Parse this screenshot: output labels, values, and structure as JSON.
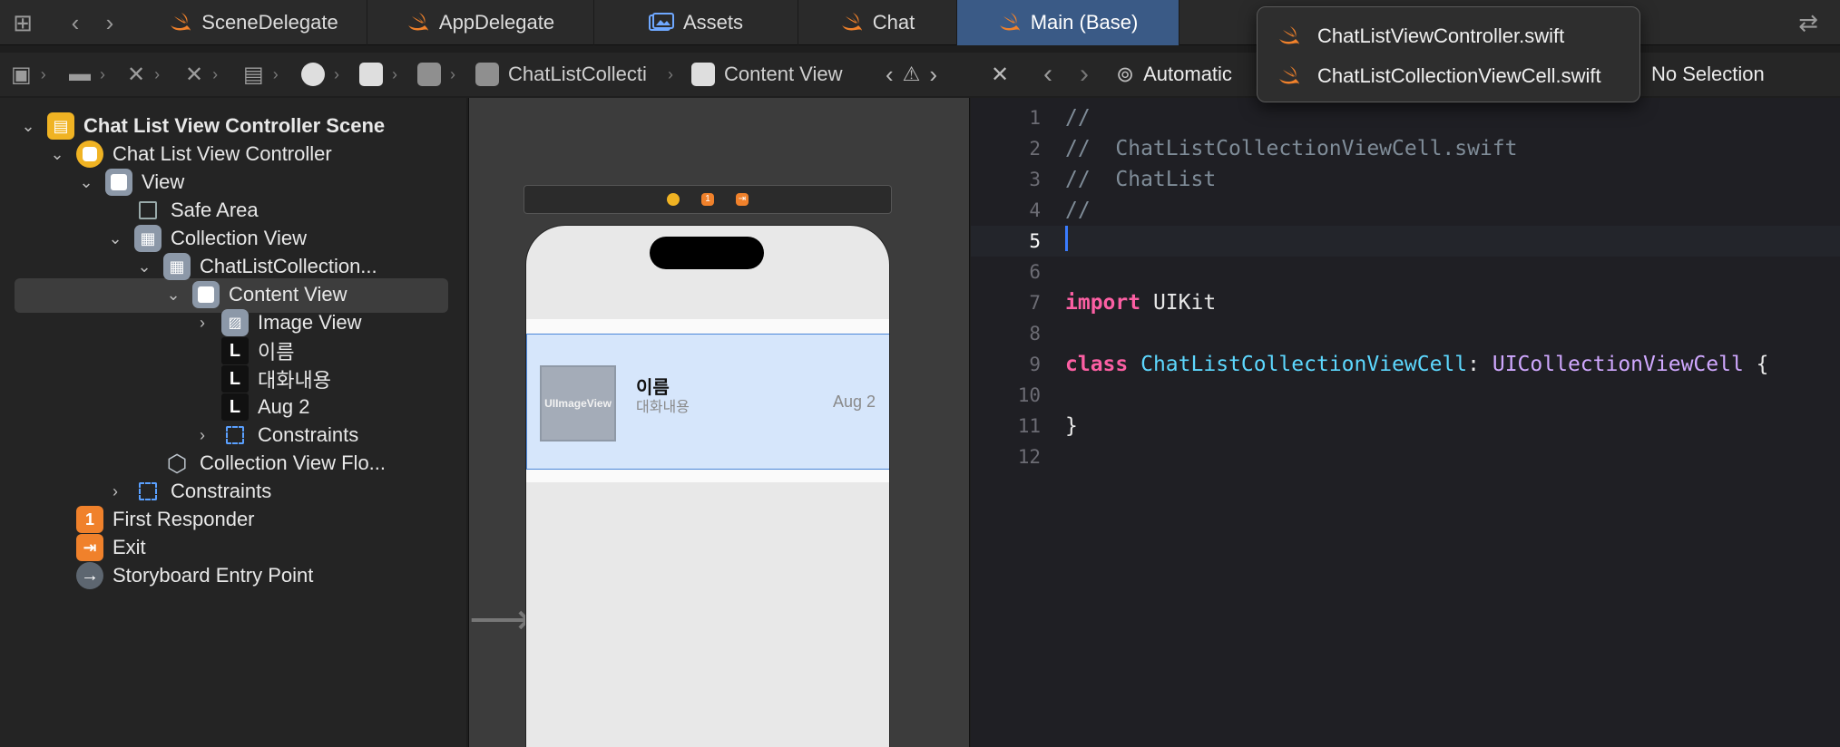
{
  "tabs": [
    {
      "label": "SceneDelegate"
    },
    {
      "label": "AppDelegate"
    },
    {
      "label": "Assets"
    },
    {
      "label": "Chat"
    },
    {
      "label": "Main (Base)"
    }
  ],
  "jump_bar": {
    "collection_cell_label": "ChatListCollecti",
    "content_view_label": "Content View"
  },
  "assistant_bar": {
    "mode_label": "Automatic",
    "selection_label": "No Selection"
  },
  "popup": {
    "items": [
      "ChatListViewController.swift",
      "ChatListCollectionViewCell.swift"
    ]
  },
  "outline": {
    "rows": [
      {
        "label": "Chat List View Controller Scene"
      },
      {
        "label": "Chat List View Controller"
      },
      {
        "label": "View"
      },
      {
        "label": "Safe Area"
      },
      {
        "label": "Collection View"
      },
      {
        "label": "ChatListCollection..."
      },
      {
        "label": "Content View"
      },
      {
        "label": "Image View"
      },
      {
        "label": "이름"
      },
      {
        "label": "대화내용"
      },
      {
        "label": "Aug 2"
      },
      {
        "label": "Constraints"
      },
      {
        "label": "Collection View Flo..."
      },
      {
        "label": "Constraints"
      },
      {
        "label": "First Responder"
      },
      {
        "label": "Exit"
      },
      {
        "label": "Storyboard Entry Point"
      }
    ],
    "icon_glyphs": {
      "label": "L",
      "first_responder": "1"
    }
  },
  "canvas": {
    "cell": {
      "image_placeholder": "UIImageView",
      "name": "이름",
      "message": "대화내용",
      "date": "Aug 2"
    }
  },
  "editor": {
    "line_numbers": [
      "1",
      "2",
      "3",
      "4",
      "5",
      "6",
      "7",
      "8",
      "9",
      "10",
      "11",
      "12"
    ],
    "comment_slashes": "//",
    "comment_file": "//  ChatListCollectionViewCell.swift",
    "comment_project": "//  ChatList",
    "kw_import": "import",
    "module": "UIKit",
    "kw_class": "class",
    "class_name": "ChatListCollectionViewCell",
    "colon": ":",
    "superclass": "UICollectionViewCell",
    "open_brace": "{",
    "close_brace": "}"
  },
  "colors": {
    "active_tab": "#3a5a86",
    "swift_orange": "#f0812b",
    "keyword_pink": "#fc5fa3",
    "type_cyan": "#5dd8ff",
    "type_purple": "#d0a8ff",
    "selection_blue": "#d6e6fb"
  }
}
